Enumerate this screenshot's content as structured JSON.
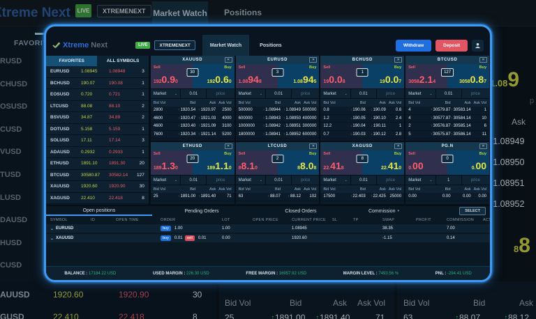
{
  "background": {
    "brand": "Xtreme Next",
    "live_badge": "LIVE",
    "account_button": "XTREMENEXT",
    "market_watch_tab": "Market Watch",
    "positions_tab": "Positions",
    "favorites_tab": "FAVORITES",
    "left_symbol_fragments": [
      "RUSD",
      "CHUSD",
      "OSUSD",
      "CUSD",
      "VUSD",
      "TUSD",
      "LUSD",
      "DAUSD",
      "HUSD",
      "CUSD"
    ],
    "right_panel": {
      "buy_price_prefix": "1.08",
      "buy_price_big": "9",
      "price_placeholder_fragment": "p",
      "ask_header": "Ask",
      "ask_values": [
        "1.08949",
        "1.08950",
        "1.08951",
        "1.08952"
      ],
      "buy2_prefix": "8",
      "buy2_big": "8"
    },
    "bottom_left_rows": [
      {
        "symbol": "AUUSD",
        "bid": "1920.60",
        "ask": "1920.90",
        "depth": "30"
      },
      {
        "symbol": "GUSD",
        "bid": "22.410",
        "ask": "22.418",
        "depth": "8"
      }
    ],
    "bottom_mid": {
      "headers": [
        "Bid Vol",
        "Bid",
        "Ask",
        "Ask Vol"
      ],
      "row": [
        "25",
        "1891.00",
        "1891.40",
        "71"
      ]
    },
    "bottom_right": {
      "headers": [
        "Bid Vol",
        "Bid",
        "Ask"
      ],
      "row": [
        "63",
        "88.07",
        "88.12"
      ]
    }
  },
  "window": {
    "header": {
      "brand_primary": "Xtreme",
      "brand_secondary": "Next",
      "live_badge": "LIVE",
      "account_button": "XTREMENEXT",
      "tabs": [
        {
          "label": "Market Watch",
          "active": true
        },
        {
          "label": "Positions",
          "active": false
        }
      ],
      "withdraw_button": "Withdraw",
      "deposit_button": "Deposit"
    },
    "sidebar": {
      "tabs": [
        {
          "label": "FAVORITES",
          "active": true
        },
        {
          "label": "ALL SYMBOLS",
          "active": false
        }
      ],
      "rows": [
        {
          "symbol": "EURUSD",
          "bid": "1.08945",
          "ask": "1.08948",
          "depth": "3"
        },
        {
          "symbol": "BCHUSD",
          "bid": "190.07",
          "ask": "190.08",
          "depth": "1"
        },
        {
          "symbol": "EOSUSD",
          "bid": "0.720",
          "ask": "0.721",
          "depth": "1"
        },
        {
          "symbol": "LTCUSD",
          "bid": "88.08",
          "ask": "88.10",
          "depth": "2"
        },
        {
          "symbol": "BSVUSD",
          "bid": "34.87",
          "ask": "34.89",
          "depth": "2"
        },
        {
          "symbol": "DOTUSD",
          "bid": "5.158",
          "ask": "5.159",
          "depth": "1"
        },
        {
          "symbol": "SOLUSD",
          "bid": "17.11",
          "ask": "17.14",
          "depth": "3"
        },
        {
          "symbol": "ADAUSD",
          "bid": "0.2932",
          "ask": "0.2933",
          "depth": "1"
        },
        {
          "symbol": "ETHUSD",
          "bid": "1891.10",
          "ask": "1891.30",
          "depth": "20"
        },
        {
          "symbol": "BTCUSD",
          "bid": "30580.87",
          "ask": "30582.14",
          "depth": "127"
        },
        {
          "symbol": "XAUUSD",
          "bid": "1920.60",
          "ask": "1920.90",
          "depth": "30"
        },
        {
          "symbol": "XAGUSD",
          "bid": "22.410",
          "ask": "22.418",
          "depth": "8"
        }
      ]
    },
    "tile_labels": {
      "sell": "Sell",
      "buy": "Buy",
      "order_type": "Market",
      "price_placeholder": "price",
      "table_headers": [
        "Bid Vol",
        "Bid",
        "Ask",
        "Ask Vol"
      ]
    },
    "tiles": [
      {
        "symbol": "XAUUSD",
        "sell": [
          "192",
          "0.9",
          "0"
        ],
        "buy": [
          "192",
          "0.6",
          "0"
        ],
        "spread": "30",
        "qty": "0.01",
        "trend": "up",
        "rows": [
          [
            "2800",
            "1920.54",
            "1920.97",
            "2500"
          ],
          [
            "4600",
            "1920.47",
            "1921.03",
            "4000"
          ],
          [
            "4600",
            "1920.40",
            "1921.09",
            "3100"
          ],
          [
            "7600",
            "1920.34",
            "1921.14",
            "5200"
          ]
        ]
      },
      {
        "symbol": "EURUSD",
        "sell": [
          "1.08",
          "94",
          "8"
        ],
        "buy": [
          "1.08",
          "94",
          "5"
        ],
        "spread": "3",
        "qty": "0.01",
        "trend": "up",
        "rows": [
          [
            "500000",
            "1.08944",
            "1.08949",
            "500000"
          ],
          [
            "600000",
            "1.08943",
            "1.08950",
            "400000"
          ],
          [
            "1000000",
            "1.08942",
            "1.08951",
            "300000"
          ],
          [
            "1800000",
            "1.08941",
            "1.08952",
            "600000"
          ]
        ]
      },
      {
        "symbol": "BCHUSD",
        "sell": [
          "19",
          "0.0",
          "8"
        ],
        "buy": [
          "19",
          "0.0",
          "7"
        ],
        "spread": "1",
        "qty": "0.01",
        "trend": "down",
        "rows": [
          [
            "0.8",
            "190.06",
            "190.09",
            "0.6"
          ],
          [
            "1.2",
            "190.05",
            "190.10",
            "2.4"
          ],
          [
            "12.2",
            "190.04",
            "190.11",
            "1"
          ],
          [
            "0.7",
            "190.03",
            "190.12",
            "2.8"
          ]
        ]
      },
      {
        "symbol": "BTCUSD",
        "sell": [
          "3058",
          "2.1",
          "4"
        ],
        "buy": [
          "3058",
          "0.8",
          "7"
        ],
        "spread": "127",
        "qty": "0.01",
        "trend": "up",
        "rows": [
          [
            "4",
            "30579.87",
            "30583.14",
            "1"
          ],
          [
            "4",
            "30577.87",
            "30584.14",
            "10"
          ],
          [
            "2",
            "30576.87",
            "30585.14",
            "6"
          ],
          [
            "5",
            "30575.87",
            "30586.14",
            "11"
          ]
        ]
      },
      {
        "symbol": "ETHUSD",
        "sell": [
          "189",
          "1.3",
          "0"
        ],
        "buy": [
          "189",
          "1.1",
          "0"
        ],
        "spread": "20",
        "qty": "0.01",
        "trend": "up",
        "rows": [
          [
            "25",
            "1891.00",
            "1891.40",
            "71"
          ]
        ]
      },
      {
        "symbol": "LTCUSD",
        "sell": [
          "8",
          "8.1",
          "0"
        ],
        "buy": [
          "8",
          "8.0",
          "8"
        ],
        "spread": "2",
        "qty": "0.01",
        "trend": "up",
        "rows": [
          [
            "63",
            "88.07",
            "88.12",
            "102"
          ]
        ]
      },
      {
        "symbol": "XAGUSD",
        "sell": [
          "22.",
          "41",
          "8"
        ],
        "buy": [
          "22.",
          "41",
          "0"
        ],
        "spread": "8",
        "qty": "0.01",
        "trend": "up",
        "rows": [
          [
            "17500",
            "22.403",
            "22.425",
            "25000"
          ]
        ]
      },
      {
        "symbol": "PG.N",
        "sell": [
          "0.",
          "00",
          ""
        ],
        "buy": [
          "0.",
          "00",
          ""
        ],
        "spread": "0",
        "qty": "1",
        "trend": "flat",
        "rows": [
          [
            "0.00",
            "0.00",
            "0.00",
            "0.00"
          ]
        ]
      }
    ],
    "positions": {
      "tabs": [
        {
          "label": "Open positions",
          "active": true
        },
        {
          "label": "Pending Orders",
          "active": false
        },
        {
          "label": "Closed Orders",
          "active": false
        },
        {
          "label": "Commission",
          "active": false,
          "caret": true
        }
      ],
      "select_button": "SELECT",
      "columns": [
        "SYMBOL",
        "ID",
        "OPEN TIME",
        "ORDER",
        "LOT",
        "OPEN PRICE",
        "CURRENT PRICE",
        "SL",
        "TP",
        "SWAP",
        "PROFIT",
        "COMMISSION",
        "ACTION"
      ],
      "rows": [
        {
          "symbol": "EURUSD",
          "id": "",
          "open_time": "",
          "orders": [
            {
              "side": "buy",
              "value": "1.00"
            }
          ],
          "lot": "1.00",
          "open_price": "",
          "current_price": "1.08945",
          "sl": "",
          "tp": "",
          "swap": "38.35",
          "profit": "",
          "commission": "7.00",
          "action": ""
        },
        {
          "symbol": "XAUUSD",
          "id": "",
          "open_time": "",
          "orders": [
            {
              "side": "buy",
              "value": "0.01"
            },
            {
              "side": "sell",
              "value": "0.01"
            }
          ],
          "lot": "0.00",
          "open_price": "",
          "current_price": "1920.60",
          "sl": "",
          "tp": "",
          "swap": "-1.15",
          "profit": "",
          "commission": "0.14",
          "action": ""
        }
      ]
    },
    "statusbar": [
      {
        "label": "BALANCE",
        "value": "17184.22 USD"
      },
      {
        "label": "USED MARGIN",
        "value": "226.30 USD"
      },
      {
        "label": "FREE MARGIN",
        "value": "16957.92 USD"
      },
      {
        "label": "MARGIN LEVEL",
        "value": "7493.56 %"
      },
      {
        "label": "PNL",
        "value": "-294.41 USD"
      }
    ]
  },
  "icons": {
    "close": "✕",
    "caret_down": "⌄",
    "caret_filled": "▾",
    "arrow_up": "↑",
    "arrow_down": "↓"
  },
  "colors": {
    "accent_blue": "#3e9af2",
    "buy_blue": "#1e6fd9",
    "sell_red": "#d94f5c",
    "bid_yellow": "#c9d44b",
    "ask_red": "#f05a68",
    "buy_price_yellow": "#e9e542",
    "sell_price_red": "#ff5d6c",
    "live_green": "#3fae47",
    "status_green": "#2fae7d"
  }
}
